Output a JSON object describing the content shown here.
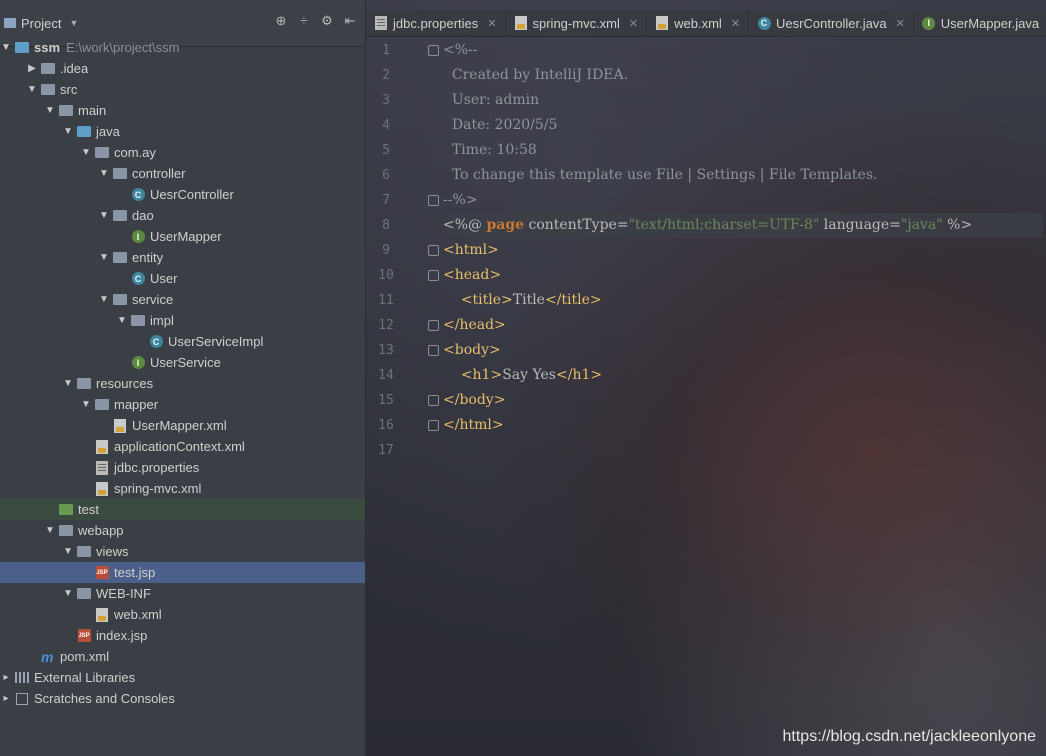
{
  "panel": {
    "title": "Project",
    "tool_icons": [
      "target-icon",
      "collapse-icon",
      "gear-icon",
      "hide-icon"
    ]
  },
  "tree": [
    {
      "depth": 0,
      "arrow": "▼",
      "icon": "project-icon",
      "label": "ssm",
      "note": "E:\\work\\project\\ssm",
      "bold": true
    },
    {
      "depth": 1,
      "arrow": "▶",
      "icon": "folder-icon",
      "label": ".idea"
    },
    {
      "depth": 1,
      "arrow": "▼",
      "icon": "folder-icon",
      "label": "src"
    },
    {
      "depth": 2,
      "arrow": "▼",
      "icon": "folder-icon",
      "label": "main"
    },
    {
      "depth": 3,
      "arrow": "▼",
      "icon": "source-folder-icon",
      "label": "java"
    },
    {
      "depth": 4,
      "arrow": "▼",
      "icon": "package-icon",
      "label": "com.ay"
    },
    {
      "depth": 5,
      "arrow": "▼",
      "icon": "package-icon",
      "label": "controller"
    },
    {
      "depth": 6,
      "arrow": "",
      "icon": "class-icon",
      "label": "UesrController"
    },
    {
      "depth": 5,
      "arrow": "▼",
      "icon": "package-icon",
      "label": "dao"
    },
    {
      "depth": 6,
      "arrow": "",
      "icon": "interface-icon",
      "label": "UserMapper"
    },
    {
      "depth": 5,
      "arrow": "▼",
      "icon": "package-icon",
      "label": "entity"
    },
    {
      "depth": 6,
      "arrow": "",
      "icon": "class-icon",
      "label": "User"
    },
    {
      "depth": 5,
      "arrow": "▼",
      "icon": "package-icon",
      "label": "service"
    },
    {
      "depth": 6,
      "arrow": "▼",
      "icon": "package-icon",
      "label": "impl"
    },
    {
      "depth": 7,
      "arrow": "",
      "icon": "class-icon",
      "label": "UserServiceImpl"
    },
    {
      "depth": 6,
      "arrow": "",
      "icon": "interface-icon",
      "label": "UserService"
    },
    {
      "depth": 3,
      "arrow": "▼",
      "icon": "resources-folder-icon",
      "label": "resources"
    },
    {
      "depth": 4,
      "arrow": "▼",
      "icon": "folder-icon",
      "label": "mapper"
    },
    {
      "depth": 5,
      "arrow": "",
      "icon": "xml-file-icon",
      "label": "UserMapper.xml"
    },
    {
      "depth": 4,
      "arrow": "",
      "icon": "xml-file-icon",
      "label": "applicationContext.xml"
    },
    {
      "depth": 4,
      "arrow": "",
      "icon": "properties-file-icon",
      "label": "jdbc.properties"
    },
    {
      "depth": 4,
      "arrow": "",
      "icon": "xml-file-icon",
      "label": "spring-mvc.xml"
    },
    {
      "depth": 2,
      "arrow": "",
      "icon": "test-folder-icon",
      "label": "test",
      "green": true
    },
    {
      "depth": 2,
      "arrow": "▼",
      "icon": "folder-icon",
      "label": "webapp"
    },
    {
      "depth": 3,
      "arrow": "▼",
      "icon": "folder-icon",
      "label": "views"
    },
    {
      "depth": 4,
      "arrow": "",
      "icon": "jsp-file-icon",
      "label": "test.jsp",
      "selected": true
    },
    {
      "depth": 3,
      "arrow": "▼",
      "icon": "folder-icon",
      "label": "WEB-INF"
    },
    {
      "depth": 4,
      "arrow": "",
      "icon": "xml-file-icon",
      "label": "web.xml"
    },
    {
      "depth": 3,
      "arrow": "",
      "icon": "jsp-file-icon",
      "label": "index.jsp"
    },
    {
      "depth": 1,
      "arrow": "",
      "icon": "maven-icon",
      "label": "pom.xml"
    },
    {
      "depth": 0,
      "arrow": "▸",
      "icon": "library-icon",
      "label": "External Libraries"
    },
    {
      "depth": 0,
      "arrow": "▸",
      "icon": "scratches-icon",
      "label": "Scratches and Consoles"
    }
  ],
  "tabs": [
    {
      "icon": "properties-file-icon",
      "label": "jdbc.properties"
    },
    {
      "icon": "xml-file-icon",
      "label": "spring-mvc.xml"
    },
    {
      "icon": "xml-file-icon",
      "label": "web.xml"
    },
    {
      "icon": "class-icon",
      "label": "UesrController.java"
    },
    {
      "icon": "interface-icon",
      "label": "UserMapper.java"
    }
  ],
  "code_lines": [
    {
      "n": "1",
      "fold": true,
      "parts": [
        {
          "t": "<%--",
          "c": "cm"
        }
      ]
    },
    {
      "n": "2",
      "parts": [
        {
          "t": "  Created by IntelliJ IDEA.",
          "c": "cm"
        }
      ]
    },
    {
      "n": "3",
      "parts": [
        {
          "t": "  User: admin",
          "c": "cm"
        }
      ]
    },
    {
      "n": "4",
      "parts": [
        {
          "t": "  Date: 2020/5/5",
          "c": "cm"
        }
      ]
    },
    {
      "n": "5",
      "parts": [
        {
          "t": "  Time: 10:58",
          "c": "cm"
        }
      ]
    },
    {
      "n": "6",
      "parts": [
        {
          "t": "  To change this template use File | Settings | File Templates.",
          "c": "cm"
        }
      ]
    },
    {
      "n": "7",
      "fold": true,
      "parts": [
        {
          "t": "--%>",
          "c": "cm"
        }
      ]
    },
    {
      "n": "8",
      "hl": true,
      "parts": [
        {
          "t": "<%@ ",
          "c": "attr"
        },
        {
          "t": "page",
          "c": "kw"
        },
        {
          "t": " contentType=",
          "c": "attr"
        },
        {
          "t": "\"text/html;charset=UTF-8\"",
          "c": "str"
        },
        {
          "t": " language=",
          "c": "attr"
        },
        {
          "t": "\"java\"",
          "c": "str"
        },
        {
          "t": " %>",
          "c": "attr"
        }
      ]
    },
    {
      "n": "9",
      "fold": true,
      "parts": [
        {
          "t": "<html>",
          "c": "tag"
        }
      ]
    },
    {
      "n": "10",
      "fold": true,
      "parts": [
        {
          "t": "<head>",
          "c": "tag"
        }
      ]
    },
    {
      "n": "11",
      "parts": [
        {
          "t": "    ",
          "c": "attr"
        },
        {
          "t": "<title>",
          "c": "tag"
        },
        {
          "t": "Title",
          "c": "attr"
        },
        {
          "t": "</title>",
          "c": "tag"
        }
      ]
    },
    {
      "n": "12",
      "fold": true,
      "parts": [
        {
          "t": "</head>",
          "c": "tag"
        }
      ]
    },
    {
      "n": "13",
      "fold": true,
      "parts": [
        {
          "t": "<body>",
          "c": "tag"
        }
      ]
    },
    {
      "n": "14",
      "parts": [
        {
          "t": "    ",
          "c": "attr"
        },
        {
          "t": "<h1>",
          "c": "tag"
        },
        {
          "t": "Say Yes",
          "c": "attr"
        },
        {
          "t": "</h1>",
          "c": "tag"
        }
      ]
    },
    {
      "n": "15",
      "fold": true,
      "parts": [
        {
          "t": "</body>",
          "c": "tag"
        }
      ]
    },
    {
      "n": "16",
      "fold": true,
      "parts": [
        {
          "t": "</html>",
          "c": "tag"
        }
      ]
    },
    {
      "n": "17",
      "parts": []
    }
  ],
  "watermark": "https://blog.csdn.net/jackleeonlyone"
}
